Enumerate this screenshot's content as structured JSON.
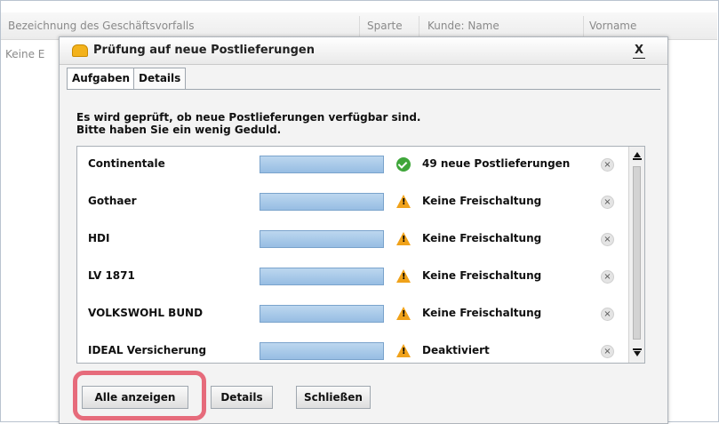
{
  "background": {
    "columns": [
      "Bezeichnung des Geschäftsvorfalls",
      "Sparte",
      "Kunde: Name",
      "Vorname"
    ],
    "row_text": "Keine E"
  },
  "dialog": {
    "title": "Prüfung auf neue Postlieferungen",
    "close_label": "X",
    "tabs": [
      {
        "label": "Aufgaben",
        "active": true
      },
      {
        "label": "Details",
        "active": false
      }
    ],
    "message_line1": "Es wird geprüft, ob neue Postlieferungen verfügbar sind.",
    "message_line2": "Bitte haben Sie ein wenig Geduld.",
    "rows": [
      {
        "name": "Continentale",
        "status_icon": "check-circle-icon",
        "status": "49 neue Postlieferungen"
      },
      {
        "name": "Gothaer",
        "status_icon": "warning-icon",
        "status": "Keine Freischaltung"
      },
      {
        "name": "HDI",
        "status_icon": "warning-icon",
        "status": "Keine Freischaltung"
      },
      {
        "name": "LV 1871",
        "status_icon": "warning-icon",
        "status": "Keine Freischaltung"
      },
      {
        "name": "VOLKSWOHL BUND",
        "status_icon": "warning-icon",
        "status": "Keine Freischaltung"
      },
      {
        "name": "IDEAL Versicherung",
        "status_icon": "warning-icon",
        "status": "Deaktiviert"
      }
    ],
    "remove_glyph": "×",
    "buttons": {
      "show_all": "Alle anzeigen",
      "details": "Details",
      "close": "Schließen"
    }
  },
  "colors": {
    "highlight": "#e66b7b",
    "progress_bar": "#a8c9e9",
    "ok": "#3fa63a",
    "warning": "#f0a21a"
  }
}
